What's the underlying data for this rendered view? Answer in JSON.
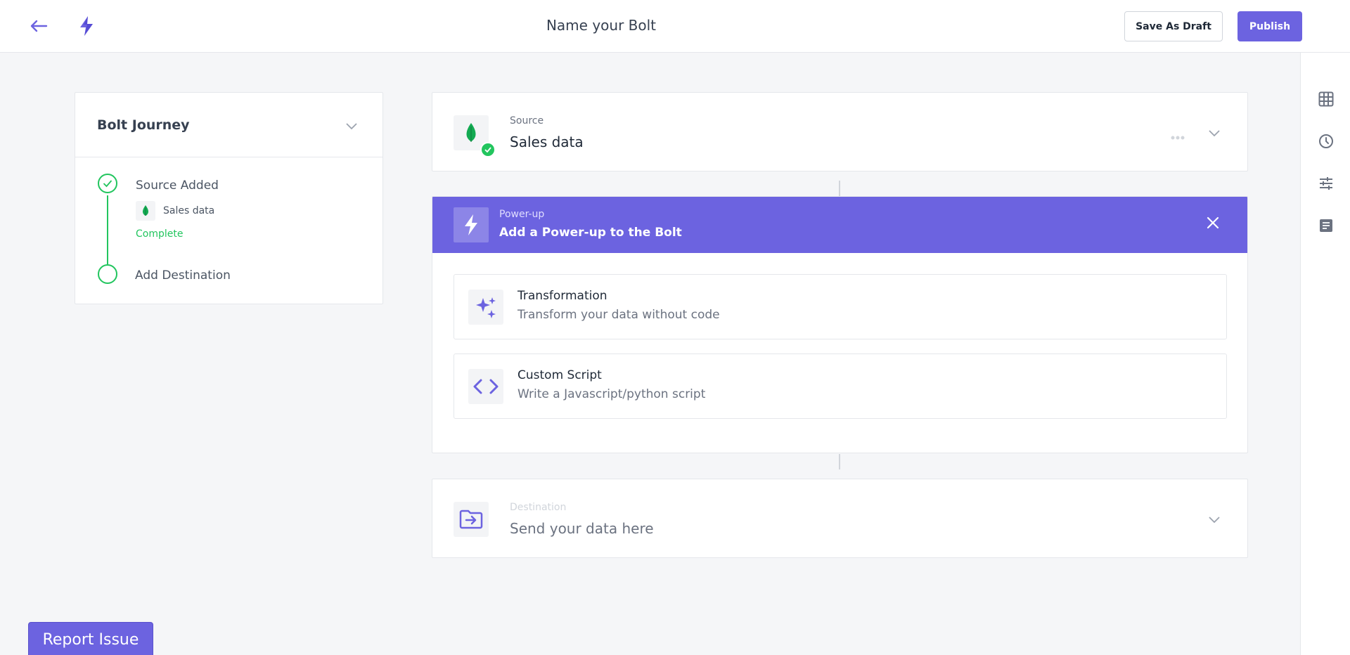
{
  "header": {
    "title": "Name your Bolt",
    "save_draft_label": "Save As Draft",
    "publish_label": "Publish"
  },
  "journey": {
    "title": "Bolt Journey",
    "steps": [
      {
        "label": "Source Added",
        "detail": "Sales data",
        "status": "Complete"
      },
      {
        "label": "Add Destination"
      }
    ]
  },
  "source": {
    "caption": "Source",
    "name": "Sales data"
  },
  "powerup": {
    "caption": "Power-up",
    "title": "Add a Power-up to the Bolt",
    "options": [
      {
        "title": "Transformation",
        "description": "Transform your data without code"
      },
      {
        "title": "Custom Script",
        "description": "Write a Javascript/python script"
      }
    ]
  },
  "destination": {
    "caption": "Destination",
    "placeholder": "Send your data here"
  },
  "report_issue_label": "Report Issue",
  "colors": {
    "accent": "#6c63e0",
    "success": "#22c55e",
    "mongodb_green": "#13aa52"
  },
  "icons": {
    "rail": [
      "table-grid-icon",
      "history-clock-icon",
      "sliders-icon",
      "document-icon"
    ]
  }
}
